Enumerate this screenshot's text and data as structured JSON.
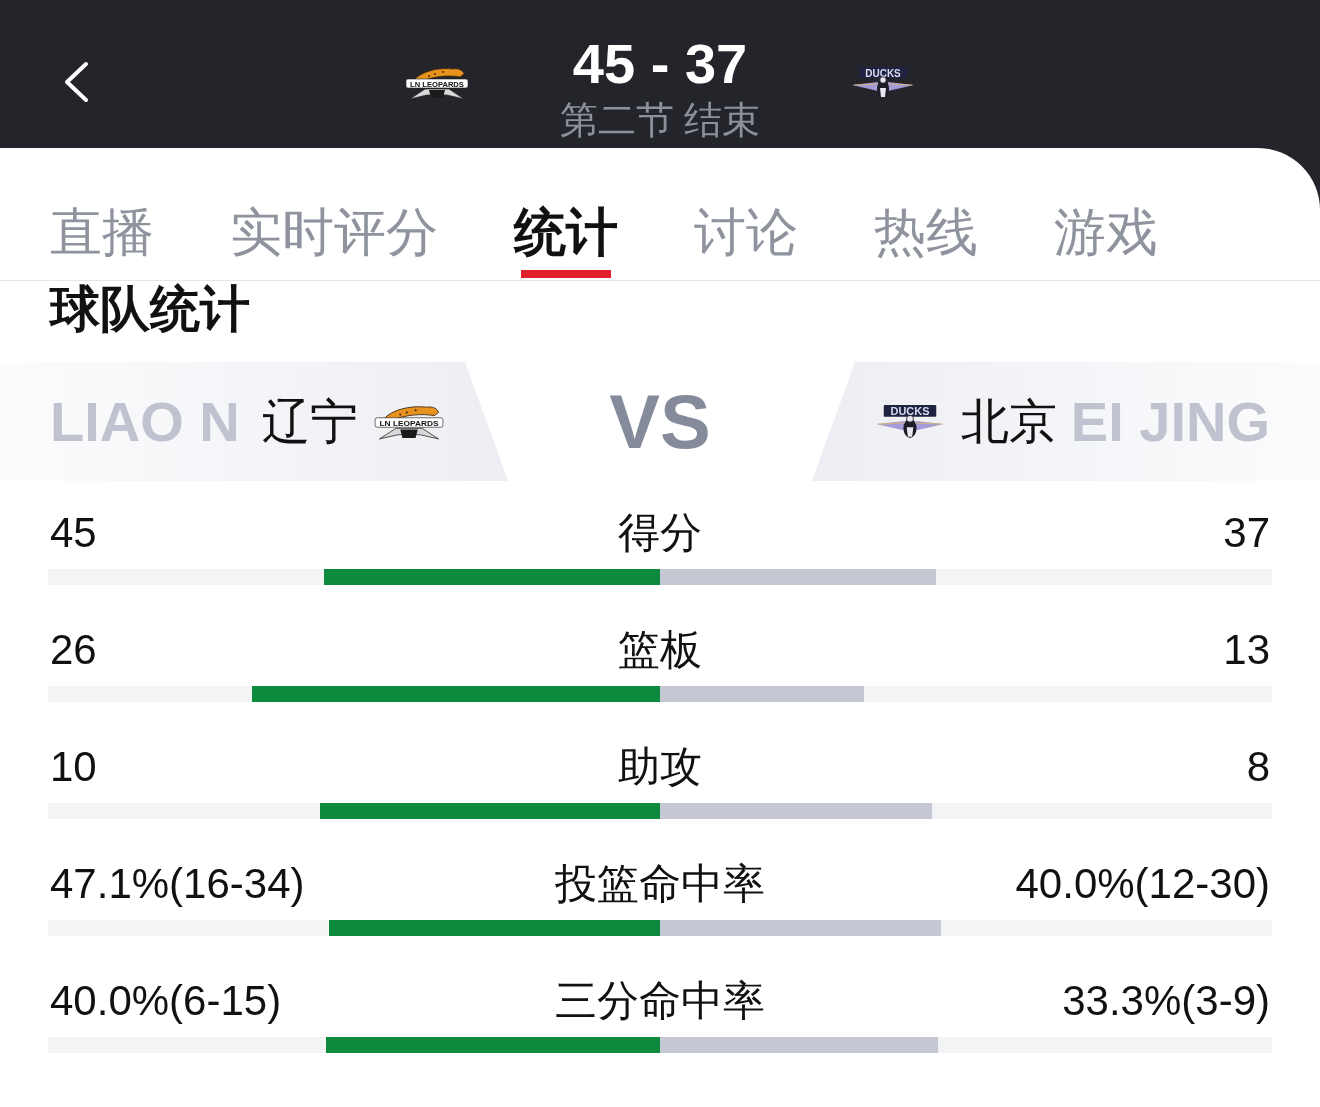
{
  "header": {
    "home_logo": {
      "kind": "leopard",
      "text": "LN LEOPARDS"
    },
    "score": "45 - 37",
    "status": "第二节 结束",
    "away_logo": {
      "kind": "duck",
      "text": "DUCKS"
    }
  },
  "tabs": [
    {
      "label": "直播",
      "selected": false
    },
    {
      "label": "实时评分",
      "selected": false
    },
    {
      "label": "统计",
      "selected": true
    },
    {
      "label": "讨论",
      "selected": false
    },
    {
      "label": "热线",
      "selected": false
    },
    {
      "label": "游戏",
      "selected": false
    }
  ],
  "section_title": "球队统计",
  "matchup": {
    "home": {
      "pinyin": "LIAO N",
      "name": "辽宁",
      "logo": {
        "kind": "leopard",
        "text": "LN LEOPARDS"
      }
    },
    "vs": "VS",
    "away": {
      "logo": {
        "kind": "duck",
        "text": "DUCKS"
      },
      "name": "北京",
      "pinyin": "EI JING"
    }
  },
  "stats": [
    {
      "label": "得分",
      "home": {
        "value": "45",
        "level": 0.549
      },
      "away": {
        "value": "37",
        "level": 0.451
      }
    },
    {
      "label": "篮板",
      "home": {
        "value": "26",
        "level": 0.667
      },
      "away": {
        "value": "13",
        "level": 0.333
      }
    },
    {
      "label": "助攻",
      "home": {
        "value": "10",
        "level": 0.556
      },
      "away": {
        "value": "8",
        "level": 0.444
      }
    },
    {
      "label": "投篮命中率",
      "home": {
        "value": "47.1%(16-34)",
        "level": 0.541
      },
      "away": {
        "value": "40.0%(12-30)",
        "level": 0.459
      }
    },
    {
      "label": "三分命中率",
      "home": {
        "value": "40.0%(6-15)",
        "level": 0.546
      },
      "away": {
        "value": "33.3%(3-9)",
        "level": 0.454
      }
    }
  ]
}
